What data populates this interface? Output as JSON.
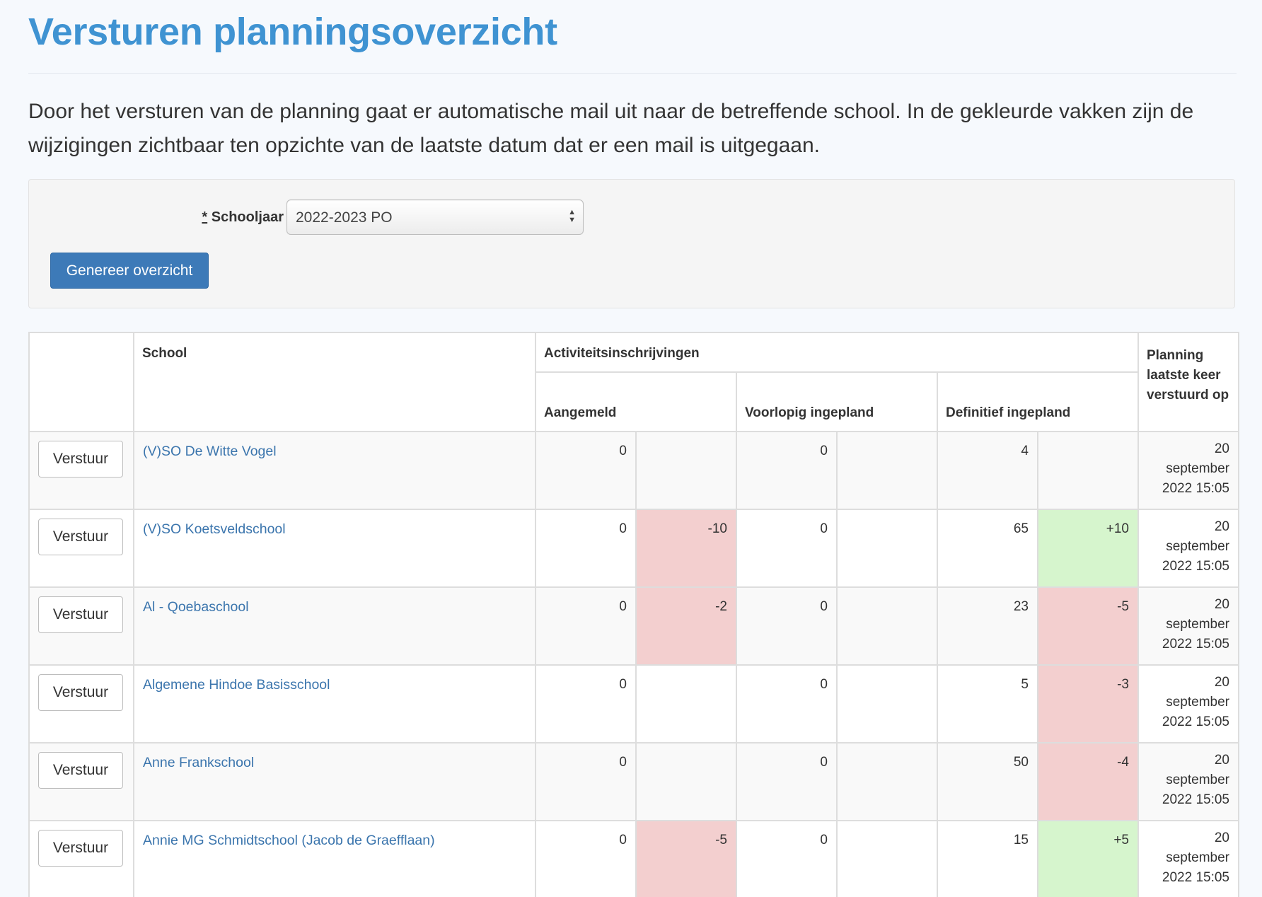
{
  "page": {
    "title": "Versturen planningsoverzicht",
    "intro": "Door het versturen van de planning gaat er automatische mail uit naar de betreffende school. In de gekleurde vakken zijn de wijzigingen zichtbaar ten opzichte van de laatste datum dat er een mail is uitgegaan."
  },
  "filter": {
    "required_mark": "*",
    "label": "Schooljaar",
    "selected_value": "2022-2023 PO",
    "submit_label": "Genereer overzicht"
  },
  "table": {
    "headers": {
      "school": "School",
      "group": "Activiteitsinschrijvingen",
      "aangemeld": "Aangemeld",
      "voorlopig": "Voorlopig ingepland",
      "definitief": "Definitief ingepland",
      "planning": "Planning laatste keer verstuurd op"
    },
    "colors": {
      "negative_change": "#f3cfcf",
      "positive_change": "#d6f5cd",
      "link": "#3b75ad"
    },
    "rows": [
      {
        "button": "Verstuur",
        "school": "(V)SO De Witte Vogel",
        "aangemeld": "0",
        "aangemeld_delta": "",
        "voorlopig": "0",
        "voorlopig_delta": "",
        "definitief": "4",
        "definitief_delta": "",
        "date": "20 september 2022 15:05"
      },
      {
        "button": "Verstuur",
        "school": "(V)SO Koetsveldschool",
        "aangemeld": "0",
        "aangemeld_delta": "-10",
        "voorlopig": "0",
        "voorlopig_delta": "",
        "definitief": "65",
        "definitief_delta": "+10",
        "date": "20 september 2022 15:05"
      },
      {
        "button": "Verstuur",
        "school": "Al - Qoebaschool",
        "aangemeld": "0",
        "aangemeld_delta": "-2",
        "voorlopig": "0",
        "voorlopig_delta": "",
        "definitief": "23",
        "definitief_delta": "-5",
        "date": "20 september 2022 15:05"
      },
      {
        "button": "Verstuur",
        "school": "Algemene Hindoe Basisschool",
        "aangemeld": "0",
        "aangemeld_delta": "",
        "voorlopig": "0",
        "voorlopig_delta": "",
        "definitief": "5",
        "definitief_delta": "-3",
        "date": "20 september 2022 15:05"
      },
      {
        "button": "Verstuur",
        "school": "Anne Frankschool",
        "aangemeld": "0",
        "aangemeld_delta": "",
        "voorlopig": "0",
        "voorlopig_delta": "",
        "definitief": "50",
        "definitief_delta": "-4",
        "date": "20 september 2022 15:05"
      },
      {
        "button": "Verstuur",
        "school": "Annie MG Schmidtschool (Jacob de Graefflaan)",
        "aangemeld": "0",
        "aangemeld_delta": "-5",
        "voorlopig": "0",
        "voorlopig_delta": "",
        "definitief": "15",
        "definitief_delta": "+5",
        "date": "20 september 2022 15:05"
      }
    ]
  }
}
